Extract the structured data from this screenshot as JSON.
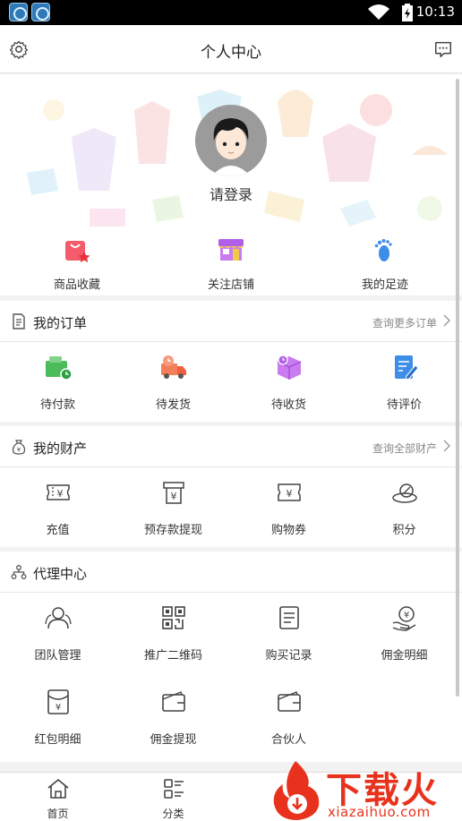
{
  "status_bar": {
    "time": "10:13"
  },
  "header": {
    "title": "个人中心"
  },
  "profile": {
    "login_label": "请登录"
  },
  "quick_links": [
    {
      "label": "商品收藏",
      "icon": "favorite-bag-icon"
    },
    {
      "label": "关注店铺",
      "icon": "store-icon"
    },
    {
      "label": "我的足迹",
      "icon": "footprint-icon"
    }
  ],
  "orders": {
    "title": "我的订单",
    "more": "查询更多订单",
    "items": [
      {
        "label": "待付款",
        "icon": "wallet-clock-icon"
      },
      {
        "label": "待发货",
        "icon": "delivery-truck-icon"
      },
      {
        "label": "待收货",
        "icon": "package-icon"
      },
      {
        "label": "待评价",
        "icon": "review-pen-icon"
      }
    ]
  },
  "assets": {
    "title": "我的财产",
    "more": "查询全部财产",
    "items": [
      {
        "label": "充值",
        "icon": "recharge-icon"
      },
      {
        "label": "预存款提现",
        "icon": "deposit-withdraw-icon"
      },
      {
        "label": "购物券",
        "icon": "voucher-icon"
      },
      {
        "label": "积分",
        "icon": "points-icon"
      }
    ]
  },
  "agent": {
    "title": "代理中心",
    "items": [
      {
        "label": "团队管理",
        "icon": "team-icon"
      },
      {
        "label": "推广二维码",
        "icon": "qrcode-icon"
      },
      {
        "label": "购买记录",
        "icon": "purchase-record-icon"
      },
      {
        "label": "佣金明细",
        "icon": "commission-icon"
      },
      {
        "label": "红包明细",
        "icon": "red-envelope-icon"
      },
      {
        "label": "佣金提现",
        "icon": "commission-withdraw-icon"
      },
      {
        "label": "合伙人",
        "icon": "partner-icon"
      }
    ]
  },
  "tabbar": [
    {
      "label": "首页",
      "icon": "home-icon"
    },
    {
      "label": "分类",
      "icon": "category-icon"
    }
  ],
  "watermark": {
    "big": "下载火",
    "small": "xiazaihuo.com"
  },
  "colors": {
    "accent_red": "#e8321d",
    "order_green": "#4cbb5b",
    "order_orange": "#f47d5a",
    "order_purple": "#b35ee8",
    "order_blue": "#3e8ee8"
  }
}
